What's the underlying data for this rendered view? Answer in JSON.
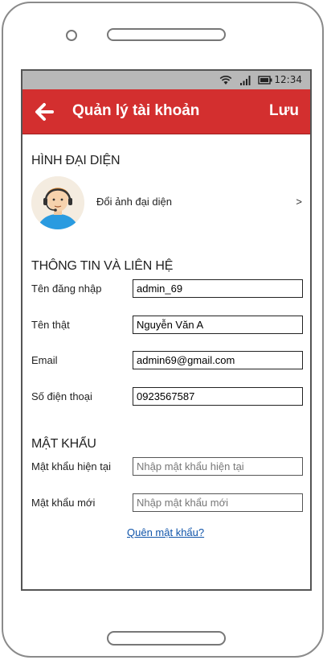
{
  "status_bar": {
    "time": "12:34",
    "icons": [
      "wifi-icon",
      "signal-icon",
      "battery-icon"
    ]
  },
  "app_bar": {
    "title": "Quản lý tài khoản",
    "back_icon": "back-arrow-icon",
    "save_label": "Lưu",
    "color": "#d32f2f"
  },
  "avatar_section": {
    "title": "HÌNH ĐẠI DIỆN",
    "change_label": "Đổi ảnh đại diện",
    "chevron": ">"
  },
  "info_section": {
    "title": "THÔNG TIN VÀ LIÊN HỆ",
    "fields": [
      {
        "label": "Tên đăng nhập",
        "value": "admin_69"
      },
      {
        "label": "Tên thật",
        "value": "Nguyễn Văn A"
      },
      {
        "label": "Email",
        "value": "admin69@gmail.com"
      },
      {
        "label": "Số điện thoại",
        "value": "0923567587"
      }
    ]
  },
  "password_section": {
    "title": "MẬT KHẨU",
    "fields": [
      {
        "label": "Mật khẩu hiện tại",
        "placeholder": "Nhập mật khẩu hiện tại"
      },
      {
        "label": "Mật khẩu mới",
        "placeholder": "Nhập mật khẩu mới"
      }
    ],
    "forgot_link": "Quên mật khẩu?"
  }
}
